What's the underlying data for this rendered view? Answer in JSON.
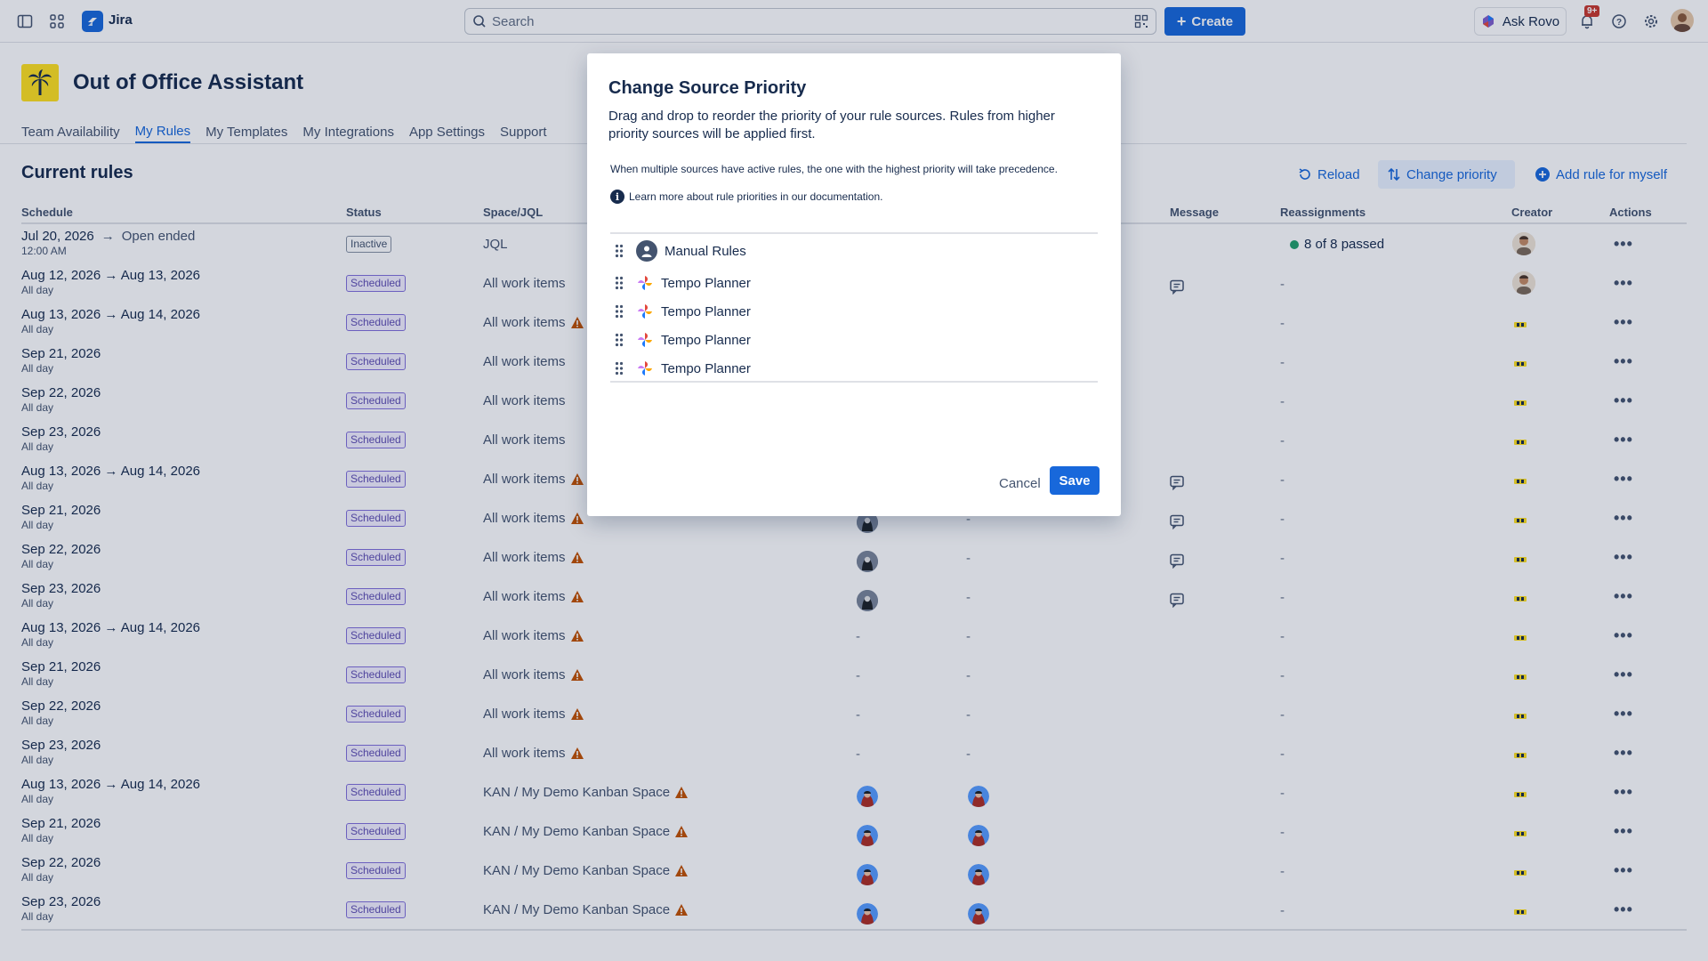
{
  "app": {
    "name": "Jira"
  },
  "search": {
    "placeholder": "Search"
  },
  "topbar": {
    "create_label": "Create",
    "rovo_label": "Ask Rovo",
    "notifications_badge": "9+"
  },
  "page": {
    "title": "Out of Office Assistant",
    "tabs": [
      "Team Availability",
      "My Rules",
      "My Templates",
      "My Integrations",
      "App Settings",
      "Support"
    ],
    "active_tab": "My Rules"
  },
  "section": {
    "title": "Current rules",
    "reload_label": "Reload",
    "change_priority_label": "Change priority",
    "add_rule_label": "Add rule for myself"
  },
  "table": {
    "headers": {
      "schedule": "Schedule",
      "status": "Status",
      "space": "Space/JQL",
      "message": "Message",
      "reassignments": "Reassignments",
      "creator": "Creator",
      "actions": "Actions"
    },
    "rows": [
      {
        "schedule": "Jul 20, 2026",
        "sub": "12:00 AM",
        "end": "Open ended",
        "status": "Inactive",
        "space": "JQL",
        "warn": false,
        "col_a": "",
        "col_b": "",
        "message": false,
        "reassign": "8 of 8 passed",
        "creator": "photo"
      },
      {
        "schedule": "Aug 12, 2026 → Aug 13, 2026",
        "sub": "All day",
        "status": "Scheduled",
        "space": "All work items",
        "warn": false,
        "col_a": "",
        "col_b": "",
        "message": true,
        "reassign": "-",
        "creator": "photo"
      },
      {
        "schedule": "Aug 13, 2026 → Aug 14, 2026",
        "sub": "All day",
        "status": "Scheduled",
        "space": "All work items",
        "warn": true,
        "col_a": "",
        "col_b": "",
        "message": false,
        "reassign": "-",
        "creator": "glyph"
      },
      {
        "schedule": "Sep 21, 2026",
        "sub": "All day",
        "status": "Scheduled",
        "space": "All work items",
        "warn": false,
        "col_a": "",
        "col_b": "",
        "message": false,
        "reassign": "-",
        "creator": "glyph"
      },
      {
        "schedule": "Sep 22, 2026",
        "sub": "All day",
        "status": "Scheduled",
        "space": "All work items",
        "warn": false,
        "col_a": "",
        "col_b": "",
        "message": false,
        "reassign": "-",
        "creator": "glyph"
      },
      {
        "schedule": "Sep 23, 2026",
        "sub": "All day",
        "status": "Scheduled",
        "space": "All work items",
        "warn": false,
        "col_a": "",
        "col_b": "",
        "message": false,
        "reassign": "-",
        "creator": "glyph"
      },
      {
        "schedule": "Aug 13, 2026 → Aug 14, 2026",
        "sub": "All day",
        "status": "Scheduled",
        "space": "All work items",
        "warn": true,
        "col_a": "",
        "col_b": "",
        "message": true,
        "reassign": "-",
        "creator": "glyph"
      },
      {
        "schedule": "Sep 21, 2026",
        "sub": "All day",
        "status": "Scheduled",
        "space": "All work items",
        "warn": true,
        "col_a": "avatar-dark",
        "col_b": "-",
        "message": true,
        "reassign": "-",
        "creator": "glyph"
      },
      {
        "schedule": "Sep 22, 2026",
        "sub": "All day",
        "status": "Scheduled",
        "space": "All work items",
        "warn": true,
        "col_a": "avatar-dark",
        "col_b": "-",
        "message": true,
        "reassign": "-",
        "creator": "glyph"
      },
      {
        "schedule": "Sep 23, 2026",
        "sub": "All day",
        "status": "Scheduled",
        "space": "All work items",
        "warn": true,
        "col_a": "avatar-dark",
        "col_b": "-",
        "message": true,
        "reassign": "-",
        "creator": "glyph"
      },
      {
        "schedule": "Aug 13, 2026 → Aug 14, 2026",
        "sub": "All day",
        "status": "Scheduled",
        "space": "All work items",
        "warn": true,
        "col_a": "-",
        "col_b": "-",
        "message": false,
        "reassign": "-",
        "creator": "glyph"
      },
      {
        "schedule": "Sep 21, 2026",
        "sub": "All day",
        "status": "Scheduled",
        "space": "All work items",
        "warn": true,
        "col_a": "-",
        "col_b": "-",
        "message": false,
        "reassign": "-",
        "creator": "glyph"
      },
      {
        "schedule": "Sep 22, 2026",
        "sub": "All day",
        "status": "Scheduled",
        "space": "All work items",
        "warn": true,
        "col_a": "-",
        "col_b": "-",
        "message": false,
        "reassign": "-",
        "creator": "glyph"
      },
      {
        "schedule": "Sep 23, 2026",
        "sub": "All day",
        "status": "Scheduled",
        "space": "All work items",
        "warn": true,
        "col_a": "-",
        "col_b": "-",
        "message": false,
        "reassign": "-",
        "creator": "glyph"
      },
      {
        "schedule": "Aug 13, 2026 → Aug 14, 2026",
        "sub": "All day",
        "status": "Scheduled",
        "space": "KAN / My Demo Kanban Space",
        "warn": true,
        "col_a": "avatar-blue",
        "col_b": "avatar-blue",
        "message": false,
        "reassign": "-",
        "creator": "glyph"
      },
      {
        "schedule": "Sep 21, 2026",
        "sub": "All day",
        "status": "Scheduled",
        "space": "KAN / My Demo Kanban Space",
        "warn": true,
        "col_a": "avatar-blue",
        "col_b": "avatar-blue",
        "message": false,
        "reassign": "-",
        "creator": "glyph"
      },
      {
        "schedule": "Sep 22, 2026",
        "sub": "All day",
        "status": "Scheduled",
        "space": "KAN / My Demo Kanban Space",
        "warn": true,
        "col_a": "avatar-blue",
        "col_b": "avatar-blue",
        "message": false,
        "reassign": "-",
        "creator": "glyph"
      },
      {
        "schedule": "Sep 23, 2026",
        "sub": "All day",
        "status": "Scheduled",
        "space": "KAN / My Demo Kanban Space",
        "warn": true,
        "col_a": "avatar-blue",
        "col_b": "avatar-blue",
        "message": false,
        "reassign": "-",
        "creator": "glyph"
      }
    ]
  },
  "modal": {
    "title": "Change Source Priority",
    "description": "Drag and drop to reorder the priority of your rule sources. Rules from higher priority sources will be applied first.",
    "note": "When multiple sources have active rules, the one with the highest priority will take precedence.",
    "info": "Learn more about rule priorities in our documentation.",
    "sources": [
      {
        "label": "Manual Rules",
        "icon": "person-icon"
      },
      {
        "label": "Tempo Planner",
        "icon": "tempo-logo-icon"
      },
      {
        "label": "Tempo Planner",
        "icon": "tempo-logo-icon"
      },
      {
        "label": "Tempo Planner",
        "icon": "tempo-logo-icon"
      },
      {
        "label": "Tempo Planner",
        "icon": "tempo-logo-icon"
      }
    ],
    "cancel_label": "Cancel",
    "save_label": "Save"
  },
  "colors": {
    "brand": "#1868db",
    "scheduled": "#5e4db2",
    "warning": "#c25100",
    "success": "#22a06b"
  }
}
